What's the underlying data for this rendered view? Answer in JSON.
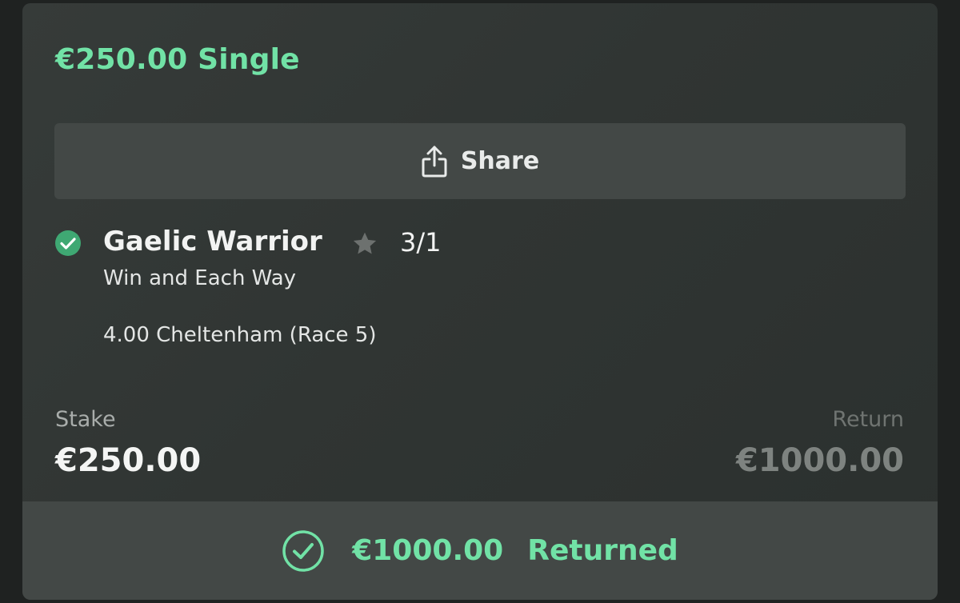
{
  "bet": {
    "title": "€250.00 Single"
  },
  "share": {
    "icon": "share-icon",
    "label": "Share"
  },
  "selection": {
    "status_icon": "check-circle-icon",
    "name": "Gaelic Warrior",
    "favorite_icon": "star-icon",
    "odds": "3/1",
    "market": "Win and Each Way",
    "event": "4.00 Cheltenham (Race 5)"
  },
  "stake": {
    "label": "Stake",
    "value": "€250.00"
  },
  "return": {
    "label": "Return",
    "value": "€1000.00"
  },
  "footer": {
    "icon": "check-circle-outline-icon",
    "amount": "€1000.00",
    "status": "Returned"
  },
  "colors": {
    "accent_green": "#71e2a6",
    "check_green": "#3fa873",
    "card_bg": "#333836",
    "button_bg": "#434846"
  }
}
